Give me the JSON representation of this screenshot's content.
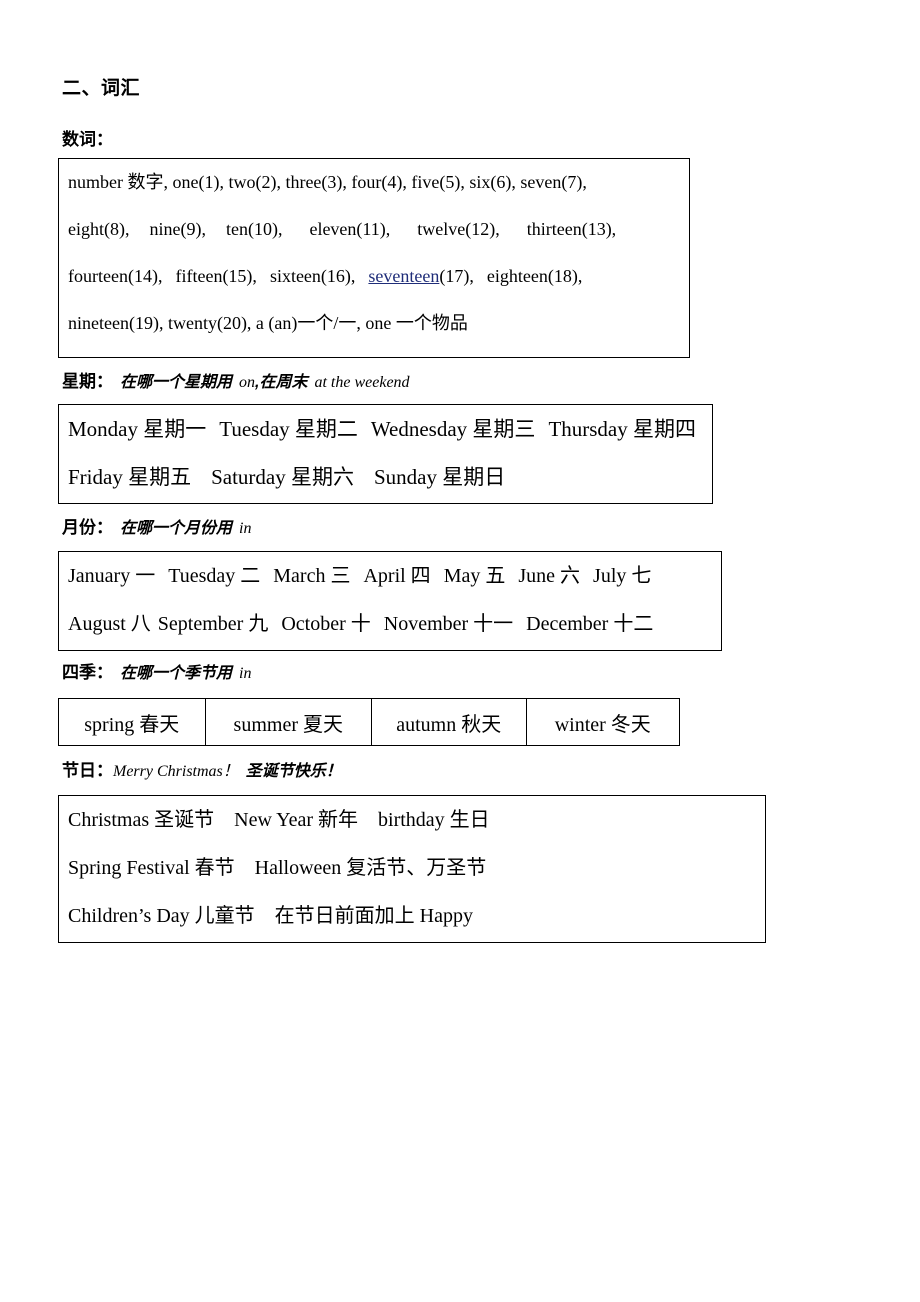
{
  "document": {
    "section_title": "二、词汇",
    "groups": [
      {
        "key": "numerals",
        "label": "数词：",
        "note_cn": "",
        "note_en": "",
        "lines": [
          "number 数字, one(1), two(2), three(3), four(4), five(5), six(6), seven(7),",
          "eight(8),   nine(9),   ten(10),   eleven(11),   twelve(12),   thirteen(13),",
          "fourteen(14),   fifteen(15),   sixteen(16),   seventeen(17),   eighteen(18),",
          "nineteen(19), twenty(20), a (an)一个/一, one 一个物品"
        ],
        "line_parts": {
          "l1_a": "number 数字, one(1), two(2), three(3), four(4), five(5), six(6), seven(7),",
          "l2_a": "eight(8),",
          "l2_b": "nine(9),",
          "l2_c": "ten(10),",
          "l2_d": "eleven(11),",
          "l2_e": "twelve(12),",
          "l2_f": "thirteen(13),",
          "l3_a": "fourteen(14),",
          "l3_b": "fifteen(15),",
          "l3_c": "sixteen(16),",
          "l3_link": "seventeen",
          "l3_d": "(17),",
          "l3_e": "eighteen(18),",
          "l4_a": "nineteen(19), twenty(20), a (an)一个/一, one 一个物品"
        }
      },
      {
        "key": "weekdays",
        "label": "星期：",
        "note_cn": "在哪一个星期用",
        "note_en": "on",
        "note_cn2": ",在周末",
        "note_en2": "at the weekend",
        "lines": [
          "Monday 星期一  Tuesday 星期二  Wednesday 星期三  Thursday 星期四",
          "Friday 星期五   Saturday 星期六   Sunday 星期日"
        ],
        "line_parts": {
          "l1_a": "Monday 星期一",
          "l1_b": "Tuesday 星期二",
          "l1_c": "Wednesday 星期三",
          "l1_d": "Thursday 星期四",
          "l2_a": "Friday 星期五",
          "l2_b": "Saturday 星期六",
          "l2_c": "Sunday 星期日"
        }
      },
      {
        "key": "months",
        "label": "月份：",
        "note_cn": "在哪一个月份用",
        "note_en": "in",
        "lines": [
          "January 一  Tuesday 二  March 三  April 四  May 五  June 六  July 七",
          "August 八 September 九  October 十  November 十一  December 十二"
        ],
        "line_parts": {
          "l1_a": "January 一",
          "l1_b": "Tuesday 二",
          "l1_c": "March 三",
          "l1_d": "April 四",
          "l1_e": "May 五",
          "l1_f": "June 六",
          "l1_g": "July 七",
          "l2_a": "August 八",
          "l2_b": "September 九",
          "l2_c": "October 十",
          "l2_d": "November 十一",
          "l2_e": "December 十二"
        }
      },
      {
        "key": "seasons",
        "label": "四季：",
        "note_cn": "在哪一个季节用",
        "note_en": "in",
        "cells": [
          "spring 春天",
          "summer 夏天",
          "autumn 秋天",
          "winter 冬天"
        ]
      },
      {
        "key": "festivals",
        "label": "节日：",
        "note_en": "Merry Christmas！",
        "note_cn": "圣诞节快乐！",
        "lines": [
          "Christmas 圣诞节   New Year 新年   birthday 生日",
          "Spring Festival 春节   Halloween 复活节、万圣节",
          "Children’s Day 儿童节   在节日前面加上 Happy"
        ],
        "line_parts": {
          "l1_a": "Christmas 圣诞节",
          "l1_b": "New Year 新年",
          "l1_c": "birthday 生日",
          "l2_a": "Spring Festival 春节",
          "l2_b": "Halloween 复活节、万圣节",
          "l3_a": "Children’s Day 儿童节",
          "l3_b": "在节日前面加上 Happy"
        }
      }
    ]
  },
  "colors": {
    "text": "#000000",
    "hyperlink": "#1f2d79",
    "border": "#000000",
    "background": "#ffffff"
  }
}
